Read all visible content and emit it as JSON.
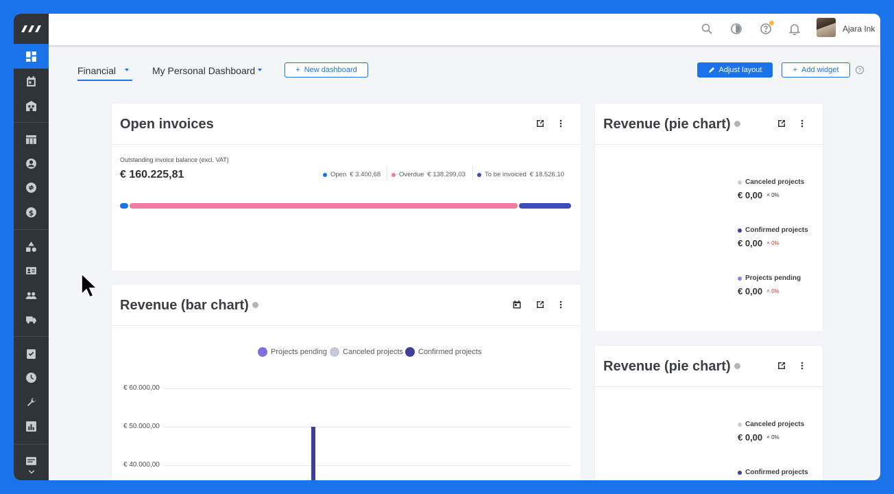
{
  "topbar": {
    "user_name": "Ajara Ink",
    "icons": [
      "search-icon",
      "theme-icon",
      "help-icon",
      "bell-icon"
    ]
  },
  "toolbar": {
    "tabs": [
      {
        "label": "Financial",
        "active": true
      },
      {
        "label": "My Personal Dashboard",
        "active": false
      }
    ],
    "new_dashboard_label": "New dashboard",
    "adjust_layout_label": "Adjust layout",
    "add_widget_label": "Add widget",
    "help_label": "?"
  },
  "sidebar": {
    "items": [
      "dashboard-icon",
      "calendar-icon",
      "building-icon",
      "table-icon",
      "person-icon",
      "sync-icon",
      "dollar-icon",
      "shapes-icon",
      "contact-card-icon",
      "group-icon",
      "truck-icon",
      "checklist-icon",
      "clock-icon",
      "wrench-icon",
      "report-icon",
      "notes-icon"
    ]
  },
  "open_invoices": {
    "title": "Open invoices",
    "subtitle": "Outstanding invoice balance (excl. VAT)",
    "total": "€ 160.225,81",
    "legend": [
      {
        "label": "Open",
        "value": "€ 3.400,68",
        "color": "#1a73e8"
      },
      {
        "label": "Overdue",
        "value": "€ 138.299,03",
        "color": "#f07aa0"
      },
      {
        "label": "To be invoiced",
        "value": "€ 18.526,10",
        "color": "#3f4bb8"
      }
    ],
    "bar_fractions": [
      0.021,
      0.863,
      0.116
    ]
  },
  "pie_widgets": [
    {
      "title": "Revenue (pie chart)",
      "entries": [
        {
          "name": "Canceled projects",
          "value": "€ 0,00",
          "change": "0%",
          "color": "#c8ccd6",
          "change_color": "#2d3138"
        },
        {
          "name": "Confirmed projects",
          "value": "€ 0,00",
          "change": "0%",
          "color": "#3f3f9a",
          "change_color": "#c0392b"
        },
        {
          "name": "Projects pending",
          "value": "€ 0,00",
          "change": "0%",
          "color": "#8a84e0",
          "change_color": "#c0392b"
        }
      ]
    },
    {
      "title": "Revenue (pie chart)",
      "entries": [
        {
          "name": "Canceled projects",
          "value": "€ 0,00",
          "change": "0%",
          "color": "#c8ccd6",
          "change_color": "#2d3138"
        },
        {
          "name": "Confirmed projects",
          "value": "",
          "change": "",
          "color": "#3f3f9a",
          "change_color": "#2d3138"
        }
      ]
    }
  ],
  "bar_widget": {
    "title": "Revenue (bar chart)"
  },
  "chart_data": {
    "type": "bar",
    "title": "Revenue (bar chart)",
    "legend_position": "top",
    "series": [
      {
        "name": "Projects pending",
        "color": "#7b73dd"
      },
      {
        "name": "Canceled projects",
        "color": "#c5c9dc"
      },
      {
        "name": "Confirmed projects",
        "color": "#3f3f9a",
        "value": 50000
      }
    ],
    "y_ticks": [
      "€ 60.000,00",
      "€ 50.000,00",
      "€ 40.000,00"
    ],
    "ylim": [
      30000,
      60000
    ],
    "grid": true
  }
}
